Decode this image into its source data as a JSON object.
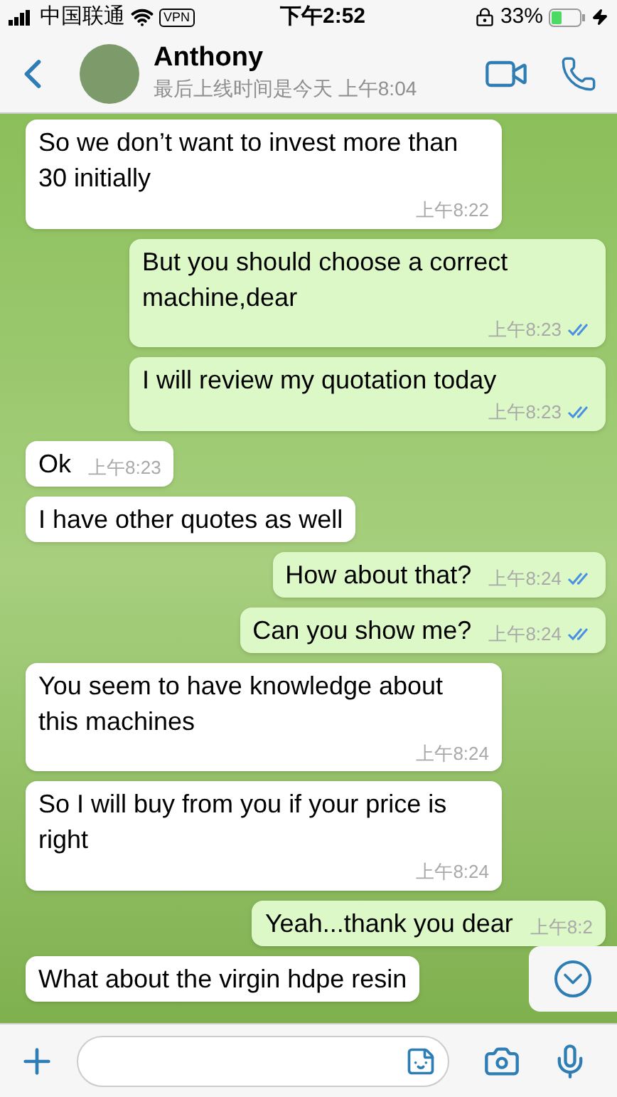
{
  "status_bar": {
    "carrier": "中国联通",
    "vpn": "VPN",
    "time": "下午2:52",
    "battery": "33%"
  },
  "header": {
    "name": "Anthony",
    "last_seen": "最后上线时间是今天 上午8:04"
  },
  "messages": [
    {
      "kind": "in",
      "text": "So we don’t want to invest more than 30 initially",
      "time": "上午8:22"
    },
    {
      "kind": "out",
      "text": "But you should choose a correct machine,dear",
      "time": "上午8:23",
      "read": true
    },
    {
      "kind": "out",
      "text": "I will review my quotation today",
      "time": "上午8:23",
      "read": true
    },
    {
      "kind": "in",
      "text": "Ok",
      "time": "上午8:23"
    },
    {
      "kind": "in",
      "text": "I have other quotes as well"
    },
    {
      "kind": "out",
      "text": "How about that?",
      "time": "上午8:24",
      "read": true
    },
    {
      "kind": "out",
      "text": "Can you show me?",
      "time": "上午8:24",
      "read": true
    },
    {
      "kind": "in",
      "text": "You seem to have knowledge about this machines",
      "time": "上午8:24"
    },
    {
      "kind": "in",
      "text": "So I will buy from you if your price is right",
      "time": "上午8:24"
    },
    {
      "kind": "out",
      "text": "Yeah...thank you dear",
      "time": "上午8:2"
    },
    {
      "kind": "in",
      "text": "What about the virgin hdpe resin"
    }
  ]
}
